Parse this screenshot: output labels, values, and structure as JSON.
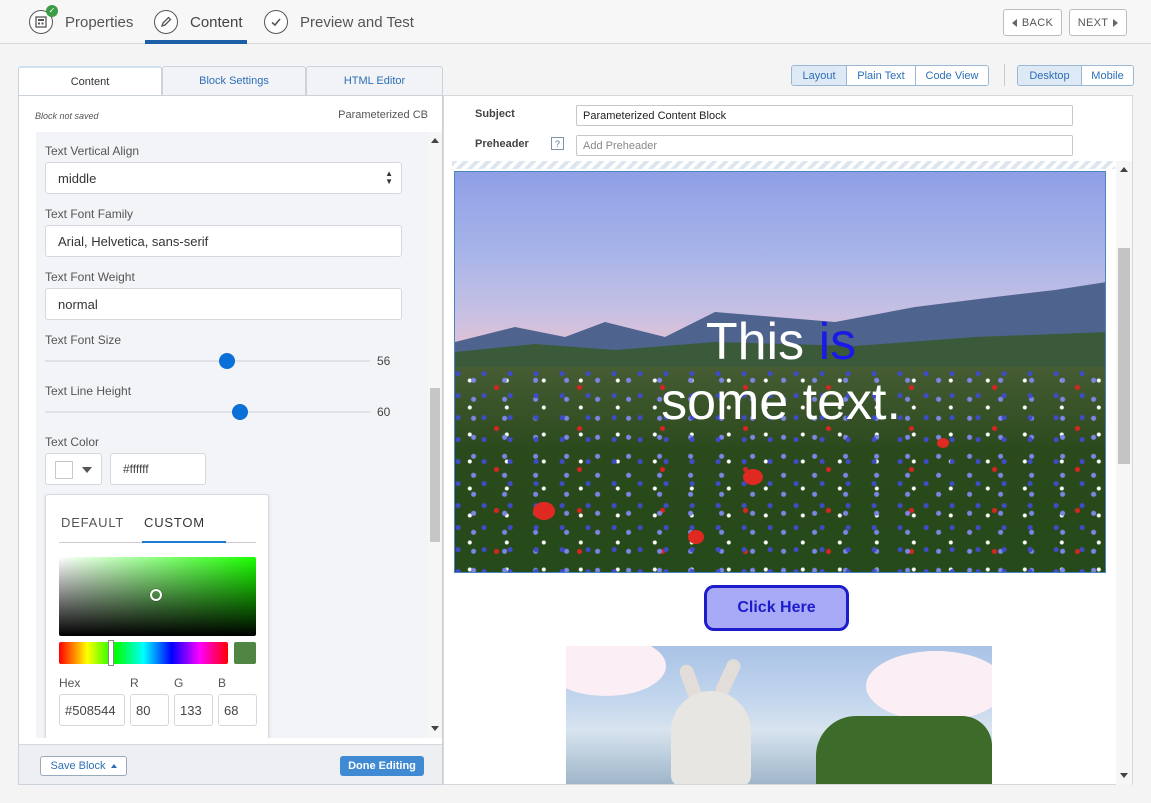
{
  "steps": [
    {
      "label": "Properties",
      "icon": "properties-icon",
      "completed": true
    },
    {
      "label": "Content",
      "icon": "pencil-icon",
      "active": true
    },
    {
      "label": "Preview and Test",
      "icon": "check-icon"
    }
  ],
  "nav": {
    "back": "BACK",
    "next": "NEXT"
  },
  "left_tabs": [
    "Content",
    "Block Settings",
    "HTML Editor"
  ],
  "left_header": {
    "status": "Block not saved",
    "block_name": "Parameterized CB"
  },
  "settings": {
    "vertical_align": {
      "label": "Text Vertical Align",
      "value": "middle"
    },
    "font_family": {
      "label": "Text Font Family",
      "value": "Arial, Helvetica, sans-serif"
    },
    "font_weight": {
      "label": "Text Font Weight",
      "value": "normal"
    },
    "font_size": {
      "label": "Text Font Size",
      "value": "56",
      "min": 0,
      "max": 100
    },
    "line_height": {
      "label": "Text Line Height",
      "value": "60",
      "min": 0,
      "max": 100
    },
    "text_color": {
      "label": "Text Color",
      "value": "#ffffff",
      "swatch": "#ffffff"
    }
  },
  "color_picker": {
    "tabs": [
      "DEFAULT",
      "CUSTOM"
    ],
    "active_tab": "CUSTOM",
    "hex_label": "Hex",
    "r_label": "R",
    "g_label": "G",
    "b_label": "B",
    "hex": "#508544",
    "r": "80",
    "g": "133",
    "b": "68",
    "current_color": "#508544"
  },
  "footer": {
    "save": "Save Block",
    "done": "Done Editing"
  },
  "view_modes": {
    "options": [
      "Layout",
      "Plain Text",
      "Code View"
    ],
    "active": "Layout"
  },
  "devices": {
    "options": [
      "Desktop",
      "Mobile"
    ],
    "active": "Desktop"
  },
  "email": {
    "subject_label": "Subject",
    "subject": "Parameterized Content Block",
    "preheader_label": "Preheader",
    "preheader_placeholder": "Add Preheader",
    "help": "?"
  },
  "hero": {
    "line1_a": "This ",
    "line1_b": "is",
    "line2": "some text.",
    "highlight_color": "#1a1ae6"
  },
  "cta": {
    "label": "Click Here"
  },
  "colors": {
    "accent": "#1c5fa8",
    "primary_button": "#3f8ad2",
    "link": "#2d6fb6"
  }
}
